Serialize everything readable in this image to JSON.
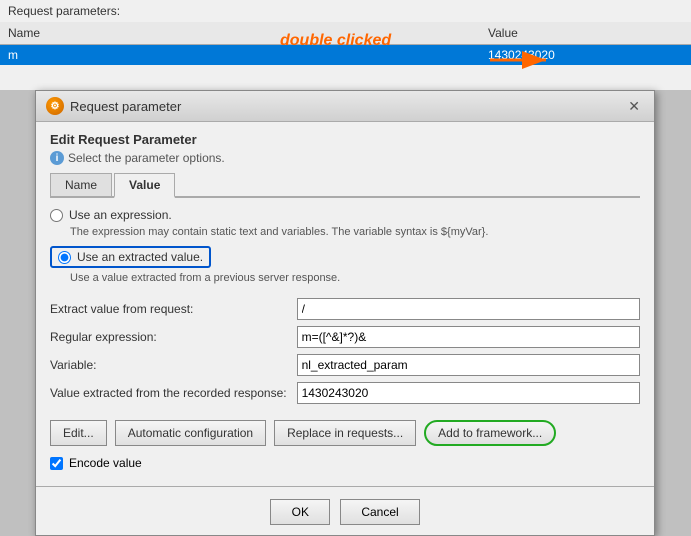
{
  "background": {
    "request_params_label": "Request parameters:",
    "table": {
      "col_name": "Name",
      "col_value": "Value",
      "row": {
        "name": "m",
        "value": "1430243020"
      }
    }
  },
  "annotation": {
    "text": "double clicked"
  },
  "modal": {
    "title": "Request parameter",
    "edit_title": "Edit Request Parameter",
    "subtitle": "Select the parameter options.",
    "tabs": [
      {
        "label": "Name",
        "active": false
      },
      {
        "label": "Value",
        "active": true
      }
    ],
    "radio_options": [
      {
        "id": "radio-expression",
        "label": "Use an expression.",
        "description": "The expression may contain static text and variables. The variable syntax is ${myVar}.",
        "selected": false
      },
      {
        "id": "radio-extracted",
        "label": "Use an extracted value.",
        "description": "Use a value extracted from a previous server response.",
        "selected": true
      }
    ],
    "form_fields": [
      {
        "label": "Extract value from request:",
        "value": "/"
      },
      {
        "label": "Regular expression:",
        "value": "m=([^&]*?)&"
      },
      {
        "label": "Variable:",
        "value": "nl_extracted_param"
      },
      {
        "label": "Value extracted from the recorded response:",
        "value": "1430243020"
      }
    ],
    "buttons": [
      {
        "label": "Edit...",
        "highlighted": false
      },
      {
        "label": "Automatic configuration",
        "highlighted": false
      },
      {
        "label": "Replace in requests...",
        "highlighted": false
      },
      {
        "label": "Add to framework...",
        "highlighted": true
      }
    ],
    "encode_checkbox": {
      "checked": true,
      "label": "Encode value"
    },
    "ok_label": "OK",
    "cancel_label": "Cancel"
  }
}
